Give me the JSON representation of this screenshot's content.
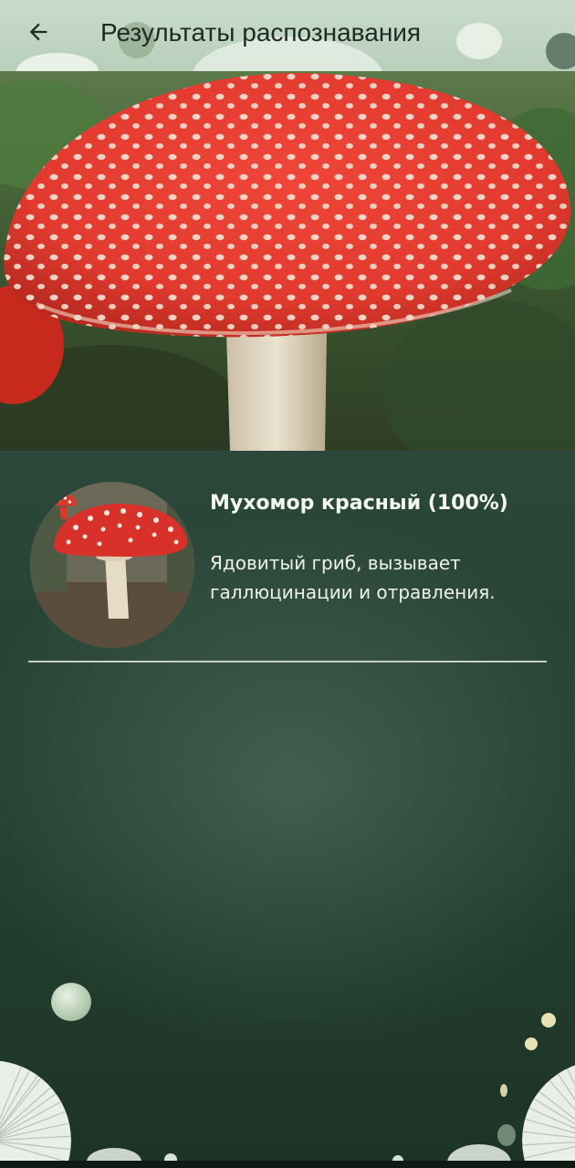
{
  "appbar": {
    "title": "Результаты распознавания",
    "back_icon": "arrow-back-icon"
  },
  "hero": {
    "image": "fly-agaric-photo"
  },
  "results": [
    {
      "name": "Мухомор красный (100%)",
      "description": "Ядовитый гриб, вызывает галлюцинации и отравления.",
      "icon": "mushroom-icon",
      "thumbnail": "fly-agaric-thumbnail"
    }
  ],
  "colors": {
    "appbar_bg": "#c3d8c5",
    "background": "#2e4a3f",
    "text_light": "#f4f7f2",
    "mushroom_red": "#d9392b",
    "divider": "#c9cec9"
  }
}
